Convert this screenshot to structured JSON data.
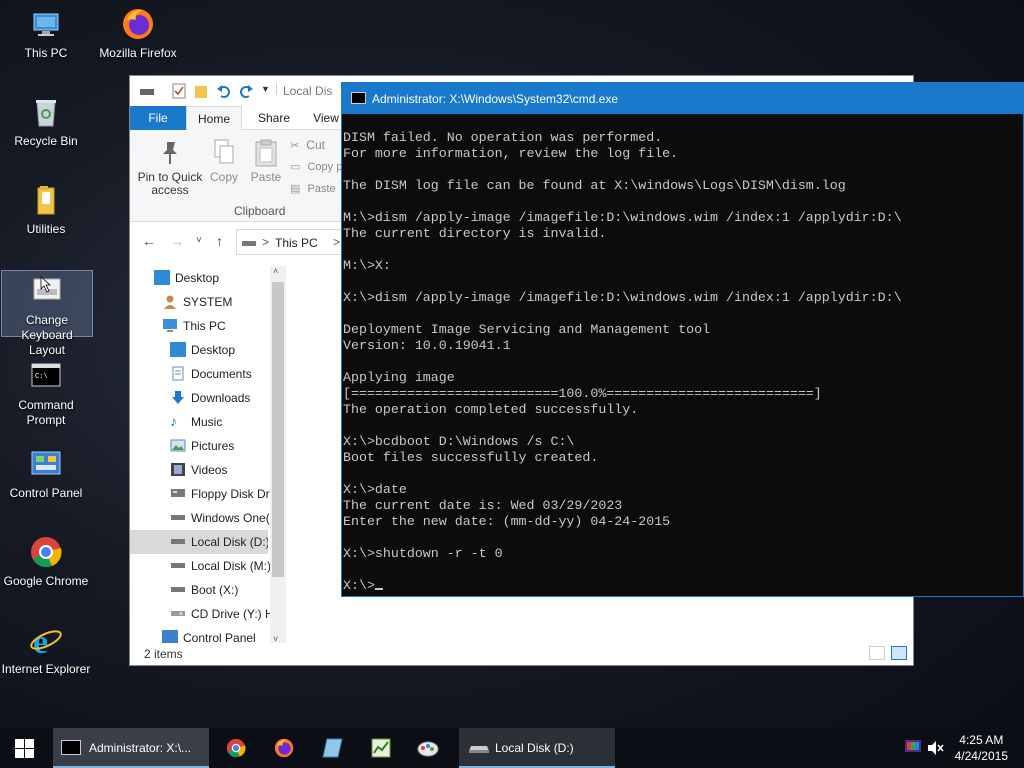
{
  "desktop": {
    "icons": [
      {
        "label": "This PC"
      },
      {
        "label": "Mozilla Firefox"
      },
      {
        "label": "Recycle Bin"
      },
      {
        "label": "Utilities"
      },
      {
        "label": "Change Keyboard Layout"
      },
      {
        "label": "Command Prompt"
      },
      {
        "label": "Control Panel"
      },
      {
        "label": "Google Chrome"
      },
      {
        "label": "Internet Explorer"
      }
    ]
  },
  "explorer": {
    "title": "Local Disk (D:)",
    "title_visible": "Local Dis",
    "tabs": {
      "file": "File",
      "home": "Home",
      "share": "Share",
      "view": "View"
    },
    "ribbon": {
      "pin": "Pin to Quick access",
      "copy": "Copy",
      "paste": "Paste",
      "cut": "Cut",
      "copy_path": "Copy pa",
      "paste_shortcut": "Paste",
      "group_clipboard": "Clipboard"
    },
    "address": {
      "crumb": "This PC",
      "sep": ">"
    },
    "nav": [
      {
        "label": "Desktop"
      },
      {
        "label": "SYSTEM"
      },
      {
        "label": "This PC"
      },
      {
        "label": "Desktop"
      },
      {
        "label": "Documents"
      },
      {
        "label": "Downloads"
      },
      {
        "label": "Music"
      },
      {
        "label": "Pictures"
      },
      {
        "label": "Videos"
      },
      {
        "label": "Floppy Disk Dri"
      },
      {
        "label": "Windows One("
      },
      {
        "label": "Local Disk (D:)"
      },
      {
        "label": "Local Disk (M:)"
      },
      {
        "label": "Boot (X:)"
      },
      {
        "label": "CD Drive (Y:) H"
      },
      {
        "label": "Control Panel"
      }
    ],
    "status": "2 items"
  },
  "cmd": {
    "title": "Administrator: X:\\Windows\\System32\\cmd.exe",
    "lines": [
      "DISM failed. No operation was performed.",
      "For more information, review the log file.",
      "",
      "The DISM log file can be found at X:\\windows\\Logs\\DISM\\dism.log",
      "",
      "M:\\>dism /apply-image /imagefile:D:\\windows.wim /index:1 /applydir:D:\\",
      "The current directory is invalid.",
      "",
      "M:\\>X:",
      "",
      "X:\\>dism /apply-image /imagefile:D:\\windows.wim /index:1 /applydir:D:\\",
      "",
      "Deployment Image Servicing and Management tool",
      "Version: 10.0.19041.1",
      "",
      "Applying image",
      "[==========================100.0%==========================]",
      "The operation completed successfully.",
      "",
      "X:\\>bcdboot D:\\Windows /s C:\\",
      "Boot files successfully created.",
      "",
      "X:\\>date",
      "The current date is: Wed 03/29/2023",
      "Enter the new date: (mm-dd-yy) 04-24-2015",
      "",
      "X:\\>shutdown -r -t 0",
      ""
    ],
    "prompt": "X:\\>"
  },
  "taskbar": {
    "cmd_label": "Administrator: X:\\...",
    "explorer_label": "Local Disk (D:)",
    "time": "4:25 AM",
    "date": "4/24/2015"
  },
  "colors": {
    "accent": "#1979ca",
    "console_bg": "#0c0c0c",
    "console_fg": "#c8c8c8",
    "taskbar": "#0b0f15"
  }
}
